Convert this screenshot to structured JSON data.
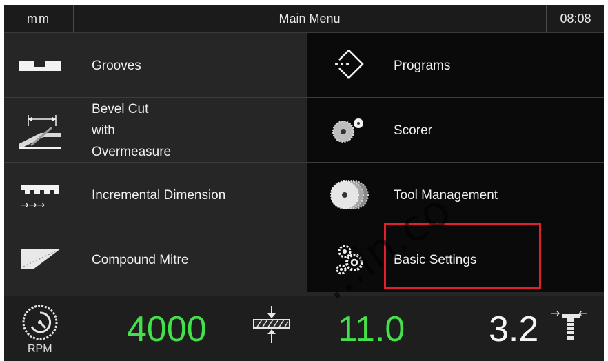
{
  "header": {
    "unit": "mm",
    "title": "Main Menu",
    "time": "08:08"
  },
  "menu": {
    "grooves": "Grooves",
    "bevel_cut_lines": [
      "Bevel Cut",
      "with",
      "Overmeasure"
    ],
    "incremental_dimension": "Incremental Dimension",
    "compound_mitre": "Compound Mitre",
    "programs": "Programs",
    "scorer": "Scorer",
    "tool_management": "Tool Management",
    "basic_settings": "Basic Settings"
  },
  "status": {
    "rpm_value": "4000",
    "rpm_label": "RPM",
    "feed_value": "11.0",
    "tool_value": "3.2"
  },
  "icons": {
    "grooves": "groove-profile-icon",
    "bevel_cut": "bevel-cut-icon",
    "incremental": "incremental-dimension-icon",
    "compound_mitre": "compound-mitre-icon",
    "programs": "programs-icon",
    "scorer": "scorer-blade-icon",
    "tool_management": "tool-stack-icon",
    "basic_settings": "gears-icon",
    "rpm": "rpm-dial-icon",
    "feed": "height-adjust-icon",
    "tool": "tool-height-icon"
  },
  "colors": {
    "value_green": "#44e04a",
    "highlight_red": "#e0202a"
  },
  "watermark": "...in.co"
}
